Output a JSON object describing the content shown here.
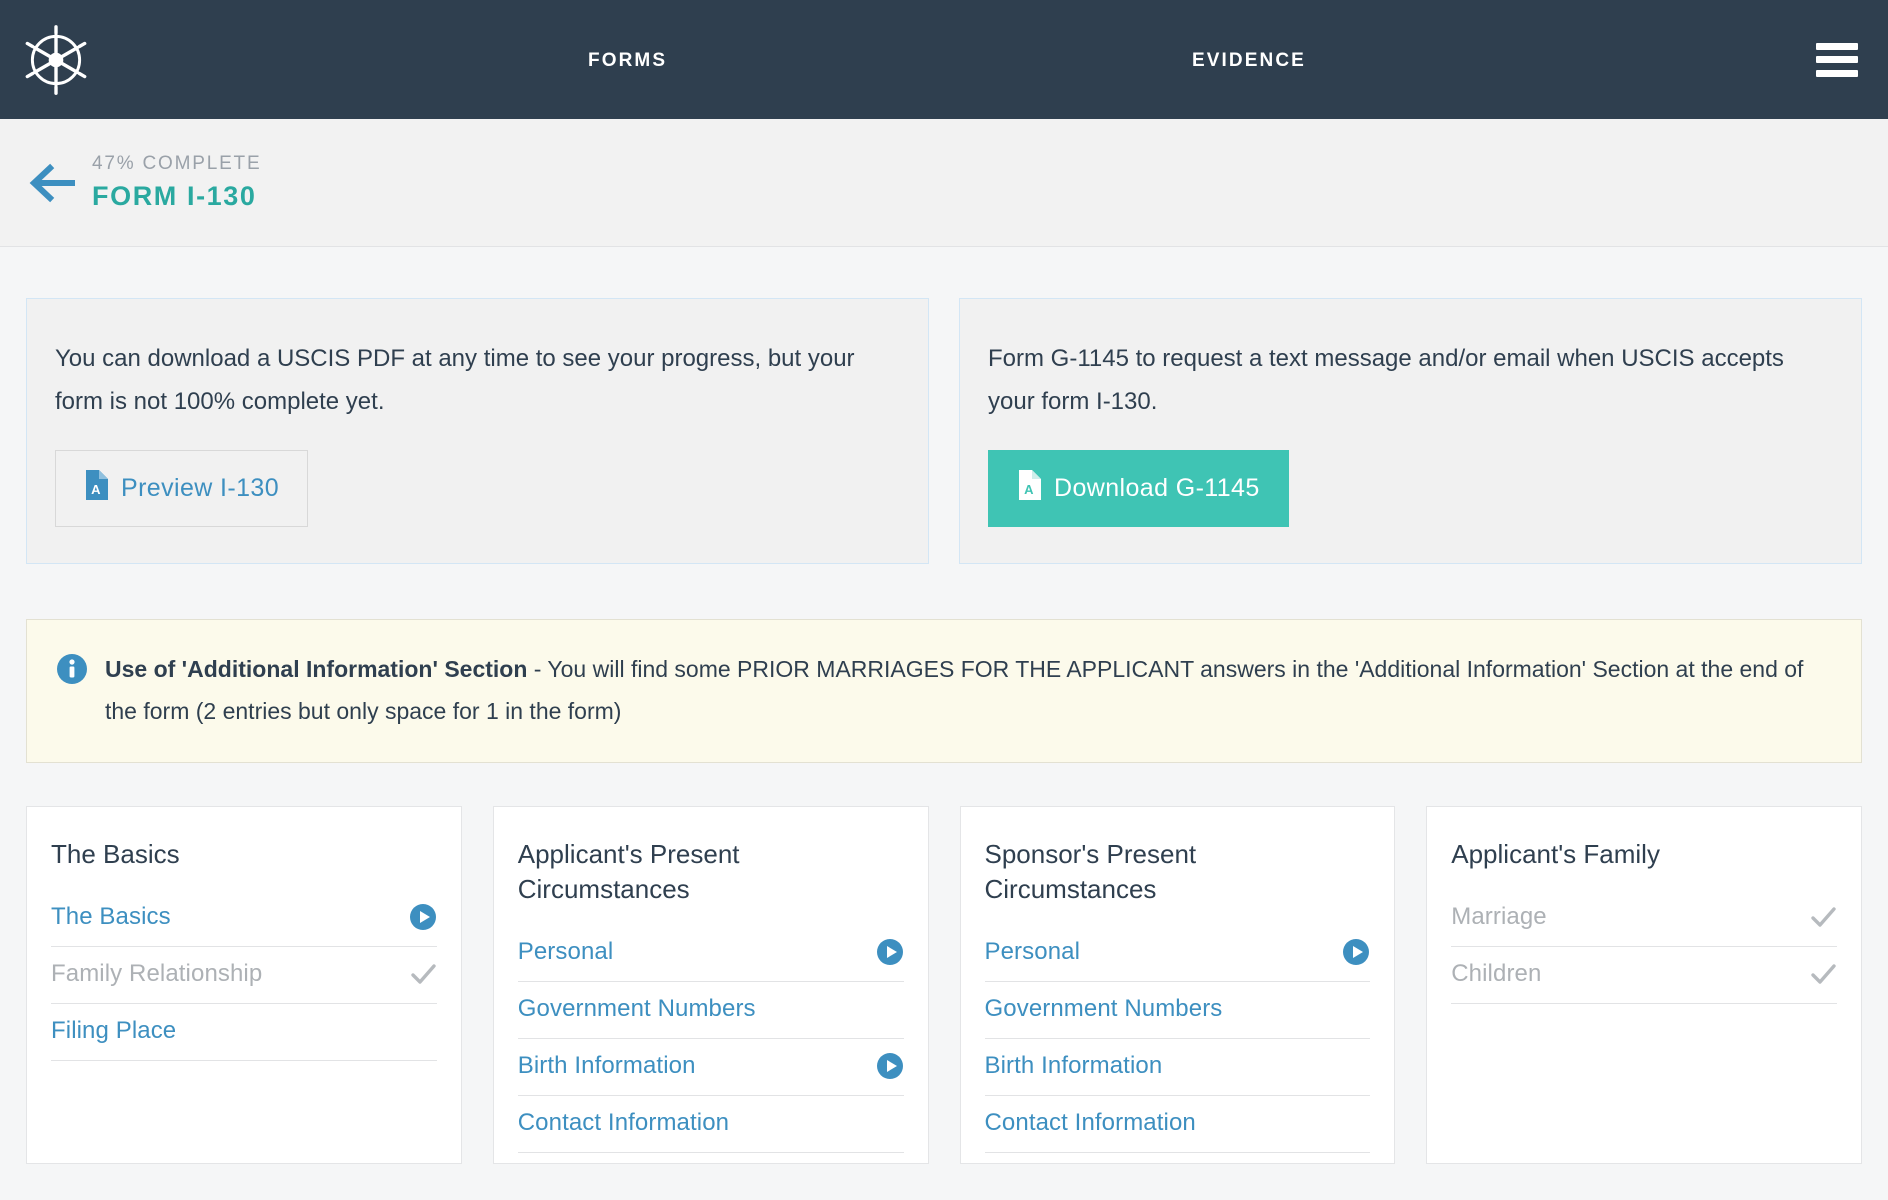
{
  "topbar": {
    "logo_icon": "ship-wheel-icon",
    "menu_icon": "hamburger-menu-icon",
    "links": [
      {
        "label": "FORMS",
        "name": "nav-link-forms"
      },
      {
        "label": "EVIDENCE",
        "name": "nav-link-evidence"
      }
    ]
  },
  "progress_header": {
    "back_icon": "arrow-left-icon",
    "percent_complete": "47% COMPLETE",
    "form_title": "FORM I-130"
  },
  "cards": [
    {
      "name": "preview-pdf-card",
      "text": "You can download a USCIS PDF at any time to see your progress, but your form is not 100% complete yet.",
      "button": {
        "label": "Preview I-130",
        "icon": "pdf-file-icon",
        "style": "outline"
      }
    },
    {
      "name": "g1145-card",
      "text": "Form G-1145 to request a text message and/or email when USCIS accepts your form I-130.",
      "button": {
        "label": "Download G-1145",
        "icon": "pdf-file-icon",
        "style": "teal"
      }
    }
  ],
  "notice": {
    "icon": "info-circle-icon",
    "bold": "Use of 'Additional Information' Section",
    "rest": " - You will find some PRIOR MARRIAGES FOR THE APPLICANT answers in the 'Additional Information' Section at the end of the form (2 entries but only space for 1 in the form)"
  },
  "sections": [
    {
      "title": "The Basics",
      "items": [
        {
          "label": "The Basics",
          "state": "active",
          "marker": "play-circle-icon"
        },
        {
          "label": "Family Relationship",
          "state": "done",
          "marker": "check-icon"
        },
        {
          "label": "Filing Place",
          "state": "active",
          "marker": "none"
        }
      ]
    },
    {
      "title": "Applicant's Present Circumstances",
      "items": [
        {
          "label": "Personal",
          "state": "active",
          "marker": "play-circle-icon"
        },
        {
          "label": "Government Numbers",
          "state": "active",
          "marker": "none"
        },
        {
          "label": "Birth Information",
          "state": "active",
          "marker": "play-circle-icon"
        },
        {
          "label": "Contact Information",
          "state": "active",
          "marker": "none"
        }
      ]
    },
    {
      "title": "Sponsor's Present Circumstances",
      "items": [
        {
          "label": "Personal",
          "state": "active",
          "marker": "play-circle-icon"
        },
        {
          "label": "Government Numbers",
          "state": "active",
          "marker": "none"
        },
        {
          "label": "Birth Information",
          "state": "active",
          "marker": "none"
        },
        {
          "label": "Contact Information",
          "state": "active",
          "marker": "none"
        }
      ]
    },
    {
      "title": "Applicant's Family",
      "items": [
        {
          "label": "Marriage",
          "state": "done",
          "marker": "check-icon"
        },
        {
          "label": "Children",
          "state": "done",
          "marker": "check-icon"
        }
      ]
    }
  ],
  "colors": {
    "navy": "#2f3f4f",
    "teal": "#2aa9a0",
    "teal_button": "#3fc4b4",
    "link_blue": "#3d8fc0",
    "muted": "#adb1b5",
    "notice_bg": "#fcfaeb"
  }
}
